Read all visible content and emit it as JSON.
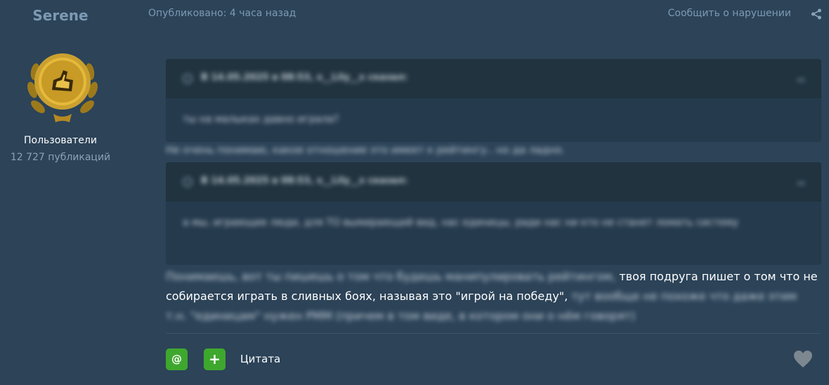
{
  "author": {
    "name": "Serene",
    "group": "Пользователи",
    "posts_count": "12 727 публикаций"
  },
  "post_meta": {
    "date": "Опубликовано: 4 часа назад",
    "report": "Сообщить о нарушении"
  },
  "quotes": [
    {
      "citation": "В 14.05.2025 в 08:53, x__Lily__x сказал:",
      "text": "ты на малыках давно играла?"
    },
    {
      "citation": "В 14.05.2025 в 08:53, x__Lily__x сказал:",
      "text": "а мы, играющие люди, для ТО вымирающий вид, нас единицы, ради нас ни кто не станет ломать систему"
    }
  ],
  "reply_between_quotes": "Не очень понимаю, какое отношение это имеет к рейтингу.. но да ладно.",
  "message": {
    "part1_blurred": "Понимаешь, вот ты пишешь о том что будешь манипулировать рейтингом,",
    "part2_clear": " твоя подруга пишет о том что не собирается играть в сливных боях, называя это \"игрой на победу\",",
    "part3_blurred": " тут вообще не похоже что даже этим т.н. \"единицам\" нужен РММ (причем в том виде, в котором они о нём говорят)"
  },
  "actions": {
    "mention": "@",
    "add": "+",
    "quote": "Цитата"
  },
  "icons": {
    "share": "share-icon",
    "like": "heart-icon",
    "avatar": "gold-medal-badge"
  },
  "colors": {
    "background": "#2c4358",
    "accent_green": "#3ea72d",
    "link": "#7d9ab4"
  }
}
